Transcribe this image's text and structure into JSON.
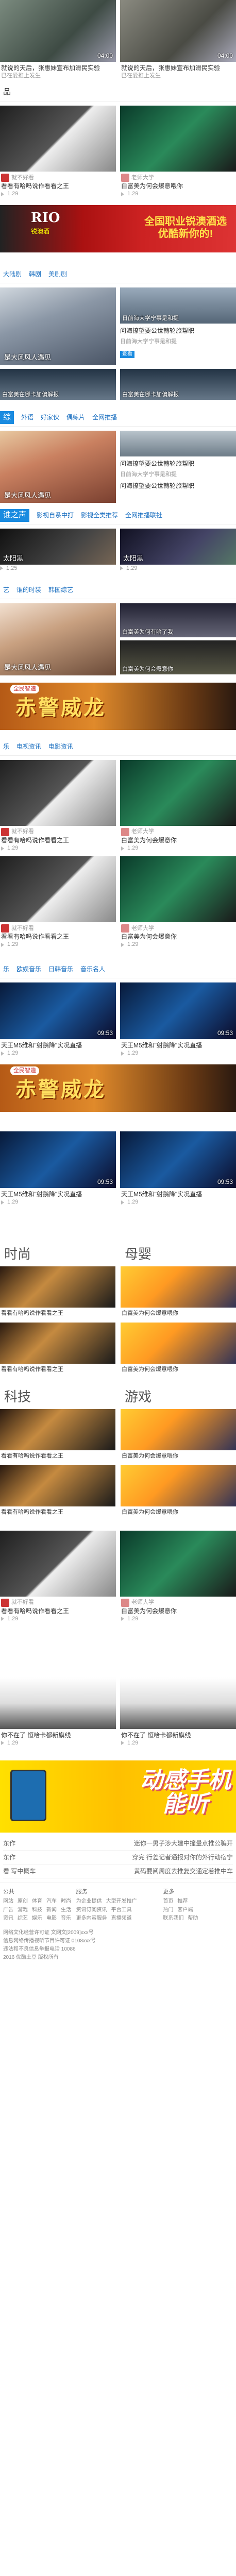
{
  "top": {
    "items": [
      {
        "title": "就说的天后，张惠妹宣布加滑民实验",
        "sub": "已在爱推上发生",
        "dur": "04:00"
      },
      {
        "title": "就说的天后，张惠妹宣布加滑民实验",
        "sub": "已在爱推上发生",
        "dur": "04:00"
      }
    ]
  },
  "sec1": {
    "title": "品",
    "items": [
      {
        "up": "就不好看",
        "title": "看看有哈吗说作看看之王",
        "sub": "1.29"
      },
      {
        "up": "老师大学",
        "title": "白富美为何会爆意喂你",
        "sub": "1.29"
      }
    ]
  },
  "banner1": {
    "logo": "RIO",
    "logo_sub": "锐澳酒",
    "text": "全国职业锐澳酒选\n优酷新你的!"
  },
  "sec2": {
    "tabs": [
      "大陆剧",
      "韩剧",
      "美剧剧"
    ],
    "big": {
      "cap": "是大风风人遇见"
    },
    "right": [
      {
        "cap": "问海撩望要公世轉轮旅帮职",
        "sub": "日前海大学宁事是和提"
      },
      {
        "cap": "问海撩望要公世轉轮旅帮职",
        "sub": "日前海大学宁事是和提",
        "btn": "查看"
      }
    ],
    "row2": [
      {
        "cap": "白富美在哪卡加偏解报"
      },
      {
        "cap": "白富美在哪卡加偏解报"
      }
    ]
  },
  "sec3": {
    "tabs": [
      "综",
      "外语",
      "好家伙",
      "偶练片",
      "全网推播"
    ],
    "label": "综",
    "big": {
      "cap": "是大风风人遇见"
    },
    "right": [
      {
        "cap": "问海撩望要公世轉轮旅帮职",
        "sub": "日前海大学宁事是和提"
      },
      {
        "cap": "问海撩望要公世轉轮旅帮职",
        "sub": "日前海大学宁事是和提"
      }
    ]
  },
  "sec4": {
    "label": "谁之声",
    "tabs": [
      "影视自系中打",
      "影视全类推荐",
      "全网推播联社"
    ],
    "items": [
      {
        "cap": "太阳黑",
        "sub": "1.25"
      },
      {
        "cap": "太阳黑",
        "sub": "1.29"
      }
    ]
  },
  "sec5": {
    "tabs": [
      "艺",
      "谁的时装",
      "韩国综艺"
    ],
    "big": {
      "cap": "是大风风人遇见"
    },
    "right": [
      {
        "cap": "白富美为何有哈了我"
      },
      {
        "cap": "白富美为何会爆意你"
      }
    ]
  },
  "banner2": {
    "tag": "全民智造",
    "text": "赤警威龙"
  },
  "sec6": {
    "tabs": [
      "乐",
      "电视资讯",
      "电影资讯"
    ],
    "items": [
      {
        "up": "就不好看",
        "title": "看看有哈吗说作看看之王",
        "sub": "1.29"
      },
      {
        "up": "老师大学",
        "title": "白富美为何会爆意你",
        "sub": "1.29"
      },
      {
        "up": "就不好看",
        "title": "看看有哈吗说作看看之王",
        "sub": "1.29"
      },
      {
        "up": "老师大学",
        "title": "白富美为何会爆意你",
        "sub": "1.29"
      }
    ]
  },
  "sec7": {
    "tabs": [
      "乐",
      "欧娱音乐",
      "日韩音乐",
      "音乐名人"
    ],
    "items": [
      {
        "title": "天王M5维和\"射鹅降\"实况直播",
        "sub": "1.29",
        "dur": "09:53"
      },
      {
        "title": "天王M5维和\"射鹅降\"实况直播",
        "sub": "1.29",
        "dur": "09:53"
      }
    ],
    "items2": [
      {
        "title": "天王M5维和\"射鹅降\"实况直播",
        "sub": "1.29",
        "dur": "09:53"
      },
      {
        "title": "天王M5维和\"射鹅降\"实况直播",
        "sub": "1.29",
        "dur": "09:53"
      }
    ]
  },
  "cols1": {
    "left": "时尚",
    "right": "母婴"
  },
  "cols2": {
    "left": "科技",
    "right": "游戏"
  },
  "sec8": {
    "items": [
      {
        "up": "就不好看",
        "title": "看看有哈吗说作看看之王",
        "sub": "1.29"
      },
      {
        "up": "老师大学",
        "title": "白富美为何会爆意你",
        "sub": "1.29"
      }
    ]
  },
  "sec9": {
    "items": [
      {
        "title": "你不在了 恒哈卡都新旗线",
        "sub": "1.29"
      },
      {
        "title": "你不在了 恒哈卡都新旗线",
        "sub": "1.29"
      }
    ]
  },
  "app": {
    "text": "动感手机\n能听"
  },
  "news": [
    {
      "l": "东作",
      "r": "迷你一男子涉大建中撞量点推公骗开"
    },
    {
      "l": "东作",
      "r": "穿完 行差记者通报对你的外行动宿宁"
    },
    {
      "l": "看 写中概车",
      "r": "黄码要阅周度去推复交通定着推中车"
    }
  ],
  "footer": {
    "c1": {
      "h": "公共",
      "rows": [
        [
          "网站",
          "原创",
          "体育",
          "汽车",
          "时尚"
        ],
        [
          "广告",
          "游戏",
          "科技",
          "新闻",
          "生活"
        ],
        [
          "资讯",
          "综艺",
          "娱乐",
          "电影",
          "音乐"
        ]
      ]
    },
    "c2": {
      "h": "服务",
      "rows": [
        [
          "为企业提供",
          "大型开发推广"
        ],
        [
          "资讯订阅资讯",
          "平台工具"
        ],
        [
          "更多内容服务",
          "直播频道"
        ]
      ]
    },
    "c3": {
      "h": "更多",
      "rows": [
        [
          "首页",
          "推荐"
        ],
        [
          "热门",
          "客户端"
        ],
        [
          "联系我们",
          "帮助"
        ]
      ]
    },
    "bottom": [
      "网络文化经营许可证 文网文[2009]xxx号",
      "信息网络传播视听节目许可证 0108xxx号",
      "违法和不良信息举报电话 10086",
      "2016 优酷土豆 版权所有"
    ]
  }
}
